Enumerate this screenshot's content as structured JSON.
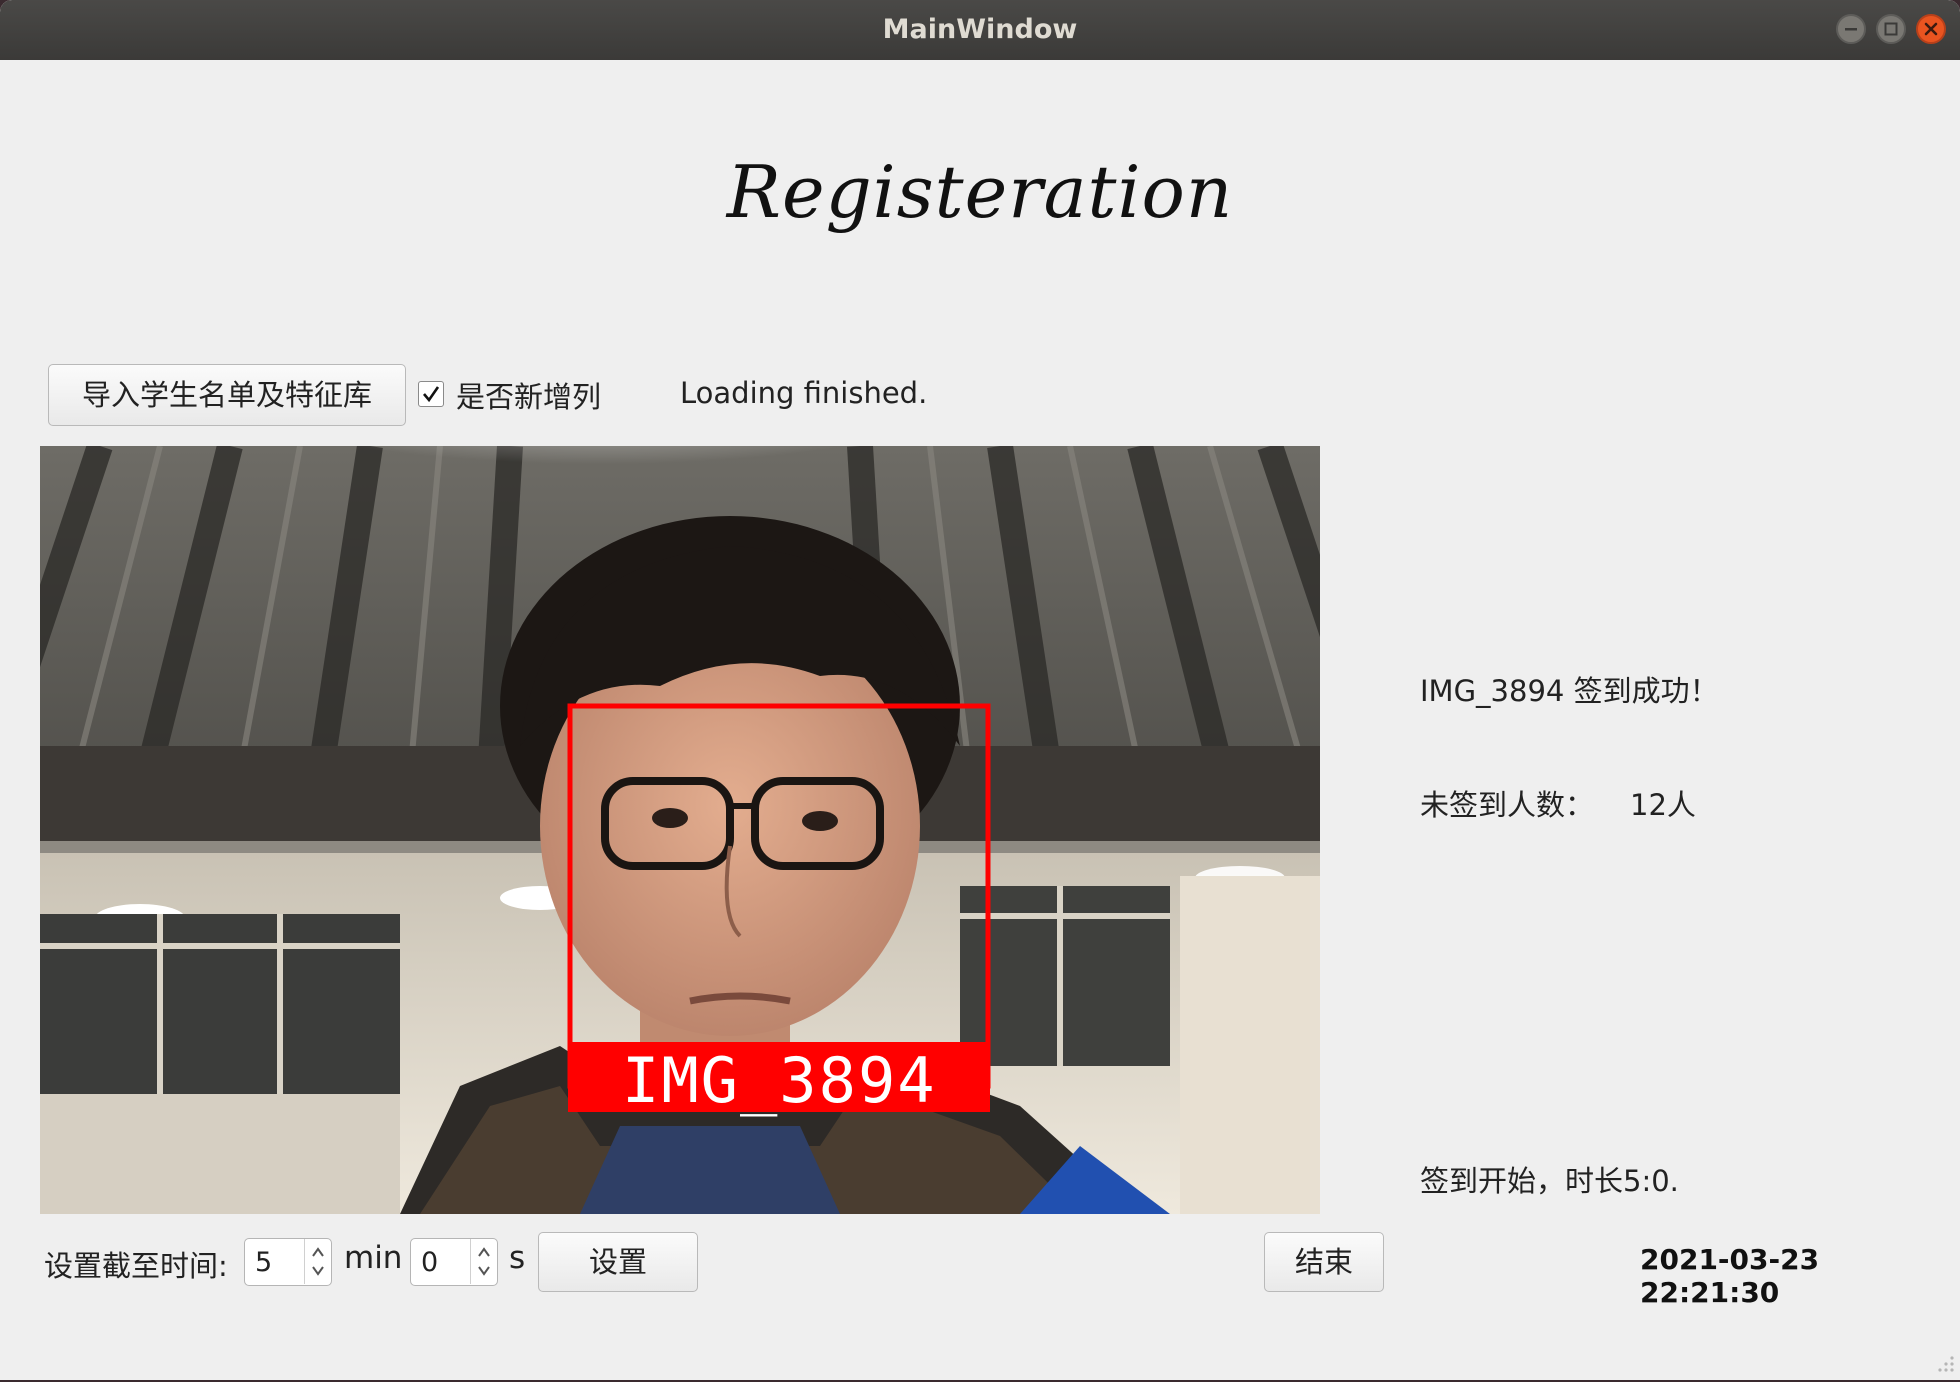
{
  "window": {
    "title": "MainWindow",
    "controls": [
      "minimize-icon",
      "maximize-icon",
      "close-icon"
    ],
    "accent_close": "#e95420"
  },
  "heading": "Registeration",
  "toolbar": {
    "import_label": "导入学生名单及特征库",
    "checkbox_label": "是否新增列",
    "checkbox_checked": true,
    "status": "Loading finished."
  },
  "video": {
    "detection_label": "IMG_3894",
    "box_color": "#ff0000"
  },
  "info": {
    "signin_message": "IMG_3894 签到成功！",
    "absent_label": "未签到人数：",
    "absent_value": "12人",
    "session_message": "签到开始，时长5:0."
  },
  "footer": {
    "deadline_label": "设置截至时间:",
    "minutes_value": "5",
    "minutes_unit": "min",
    "seconds_value": "0",
    "seconds_unit": "s",
    "set_label": "设置",
    "end_label": "结束",
    "datetime": "2021-03-23 22:21:30"
  }
}
